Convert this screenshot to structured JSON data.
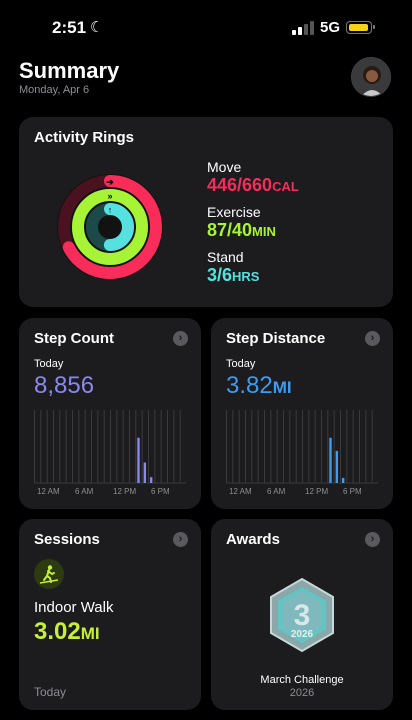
{
  "status_bar": {
    "time": "2:51",
    "network": "5G"
  },
  "header": {
    "title": "Summary",
    "date": "Monday, Apr 6"
  },
  "activity": {
    "title": "Activity Rings",
    "move": {
      "label": "Move",
      "value": "446/660",
      "unit": "CAL",
      "color": "#fa2d5a",
      "fraction": 0.676
    },
    "exercise": {
      "label": "Exercise",
      "value": "87/40",
      "unit": "MIN",
      "color": "#a7f335",
      "fraction": 2.175
    },
    "stand": {
      "label": "Stand",
      "value": "3/6",
      "unit": "HRS",
      "color": "#55e1e0",
      "fraction": 0.5
    }
  },
  "step_count": {
    "title": "Step Count",
    "period": "Today",
    "value": "8,856",
    "color": "#8b87f0",
    "axis_labels": [
      "12 AM",
      "6 AM",
      "12 PM",
      "6 PM"
    ],
    "hourly_fraction": [
      0,
      0,
      0,
      0,
      0,
      0,
      0,
      0,
      0,
      0,
      0,
      0,
      0,
      0,
      0,
      0,
      0.62,
      0.28,
      0.08,
      0,
      0,
      0,
      0,
      0
    ]
  },
  "step_distance": {
    "title": "Step Distance",
    "period": "Today",
    "value": "3.82",
    "unit": "MI",
    "color": "#3b9cf2",
    "axis_labels": [
      "12 AM",
      "6 AM",
      "12 PM",
      "6 PM"
    ],
    "hourly_fraction": [
      0,
      0,
      0,
      0,
      0,
      0,
      0,
      0,
      0,
      0,
      0,
      0,
      0,
      0,
      0,
      0,
      0.62,
      0.44,
      0.07,
      0,
      0,
      0,
      0,
      0
    ]
  },
  "sessions": {
    "title": "Sessions",
    "activity": "Indoor Walk",
    "value": "3.02",
    "unit": "MI",
    "period": "Today",
    "icon": "indoor-walk-icon",
    "color": "#c5f03a"
  },
  "awards": {
    "title": "Awards",
    "award_name": "March Challenge",
    "year": "2026"
  }
}
